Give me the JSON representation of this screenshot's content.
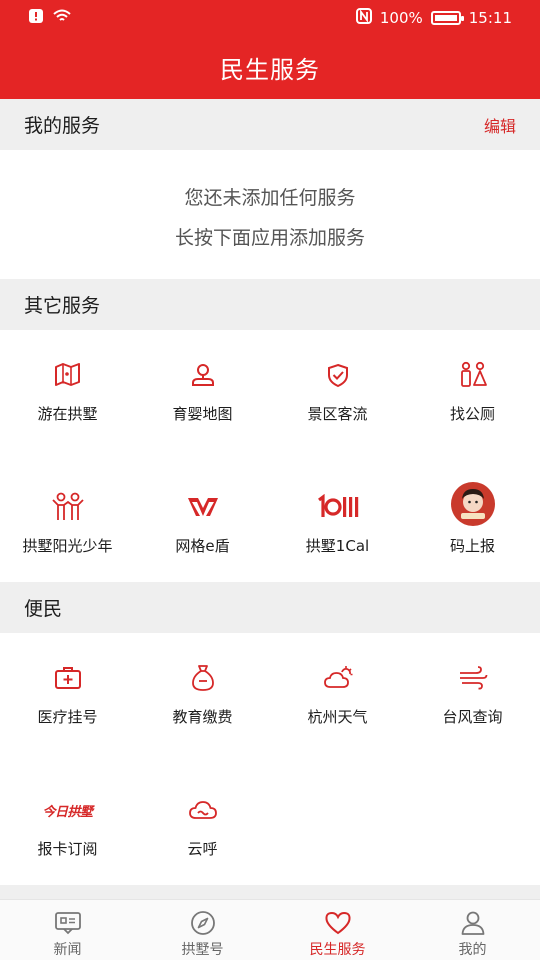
{
  "status_bar": {
    "battery_text": "100%",
    "time": "15:11",
    "battery_level": 1.0
  },
  "header": {
    "title": "民生服务"
  },
  "my_services": {
    "title": "我的服务",
    "edit_label": "编辑",
    "empty_line1": "您还未添加任何服务",
    "empty_line2": "长按下面应用添加服务"
  },
  "other_services": {
    "title": "其它服务",
    "items": [
      {
        "label": "游在拱墅",
        "icon": "map-icon"
      },
      {
        "label": "育婴地图",
        "icon": "map-pin-icon"
      },
      {
        "label": "景区客流",
        "icon": "heart-check-icon"
      },
      {
        "label": "找公厕",
        "icon": "restroom-icon"
      },
      {
        "label": "拱墅阳光少年",
        "icon": "children-icon"
      },
      {
        "label": "网格e盾",
        "icon": "shield-logo-icon"
      },
      {
        "label": "拱墅1Cal",
        "icon": "1cal-logo-icon"
      },
      {
        "label": "码上报",
        "icon": "avatar-logo-icon"
      }
    ]
  },
  "convenience": {
    "title": "便民",
    "items": [
      {
        "label": "医疗挂号",
        "icon": "medical-kit-icon"
      },
      {
        "label": "教育缴费",
        "icon": "money-bag-icon"
      },
      {
        "label": "杭州天气",
        "icon": "weather-icon"
      },
      {
        "label": "台风查询",
        "icon": "wind-icon"
      },
      {
        "label": "报卡订阅",
        "icon": "newspaper-logo-icon",
        "logo_text": "今日拱墅"
      },
      {
        "label": "云呼",
        "icon": "cloud-icon"
      }
    ]
  },
  "bottom_nav": {
    "tabs": [
      {
        "label": "新闻",
        "icon": "news-icon",
        "active": false
      },
      {
        "label": "拱墅号",
        "icon": "compass-icon",
        "active": false
      },
      {
        "label": "民生服务",
        "icon": "heart-icon",
        "active": true
      },
      {
        "label": "我的",
        "icon": "user-icon",
        "active": false
      }
    ]
  },
  "colors": {
    "brand_red": "#e42525",
    "accent_red": "#d62828",
    "section_bg": "#efefef"
  }
}
